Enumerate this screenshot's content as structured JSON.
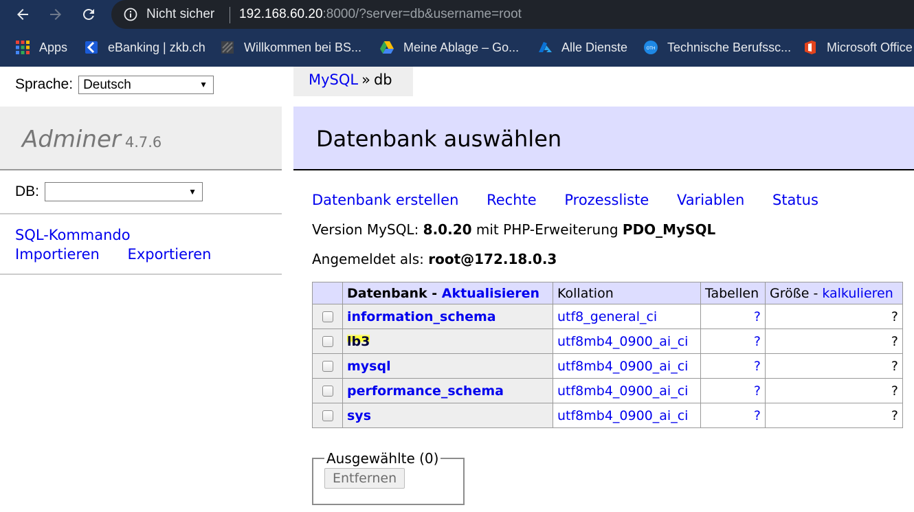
{
  "browser": {
    "security_label": "Nicht sicher",
    "url_host": "192.168.60.20",
    "url_rest": ":8000/?server=db&username=root",
    "bookmarks": [
      {
        "label": "Apps",
        "icon": "apps-grid-icon"
      },
      {
        "label": "eBanking | zkb.ch",
        "icon": "zkb-icon"
      },
      {
        "label": "Willkommen bei BS...",
        "icon": "bookmark-site-icon"
      },
      {
        "label": "Meine Ablage – Go...",
        "icon": "google-drive-icon"
      },
      {
        "label": "Alle Dienste",
        "icon": "azure-icon"
      },
      {
        "label": "Technische Berufssc...",
        "icon": "otm-icon"
      },
      {
        "label": "Microsoft Office",
        "icon": "office-icon"
      }
    ]
  },
  "sidebar": {
    "language_label": "Sprache:",
    "language_value": "Deutsch",
    "app_name": "Adminer",
    "app_version": "4.7.6",
    "db_label": "DB:",
    "db_value": "",
    "links": {
      "sql": "SQL-Kommando",
      "import": "Importieren",
      "export": "Exportieren"
    }
  },
  "breadcrumb": {
    "root": "MySQL",
    "separator": "»",
    "current": "db"
  },
  "main": {
    "title": "Datenbank auswählen",
    "menu": [
      "Datenbank erstellen",
      "Rechte",
      "Prozessliste",
      "Variablen",
      "Status"
    ],
    "version_prefix": "Version MySQL: ",
    "version_value": "8.0.20",
    "version_middle": " mit PHP-Erweiterung ",
    "version_ext": "PDO_MySQL",
    "login_prefix": "Angemeldet als: ",
    "login_value": "root@172.18.0.3"
  },
  "table": {
    "header_db": "Datenbank",
    "header_dash": " - ",
    "header_refresh": "Aktualisieren",
    "header_collation": "Kollation",
    "header_tables": "Tabellen",
    "header_size": "Größe",
    "header_size_dash": " - ",
    "header_compute": "kalkulieren",
    "rows": [
      {
        "name": "information_schema",
        "collation": "utf8_general_ci",
        "tables": "?",
        "size": "?"
      },
      {
        "name": "lb3",
        "collation": "utf8mb4_0900_ai_ci",
        "tables": "?",
        "size": "?"
      },
      {
        "name": "mysql",
        "collation": "utf8mb4_0900_ai_ci",
        "tables": "?",
        "size": "?"
      },
      {
        "name": "performance_schema",
        "collation": "utf8mb4_0900_ai_ci",
        "tables": "?",
        "size": "?"
      },
      {
        "name": "sys",
        "collation": "utf8mb4_0900_ai_ci",
        "tables": "?",
        "size": "?"
      }
    ]
  },
  "selection": {
    "legend": "Ausgewählte (0)",
    "remove_button": "Entfernen"
  }
}
